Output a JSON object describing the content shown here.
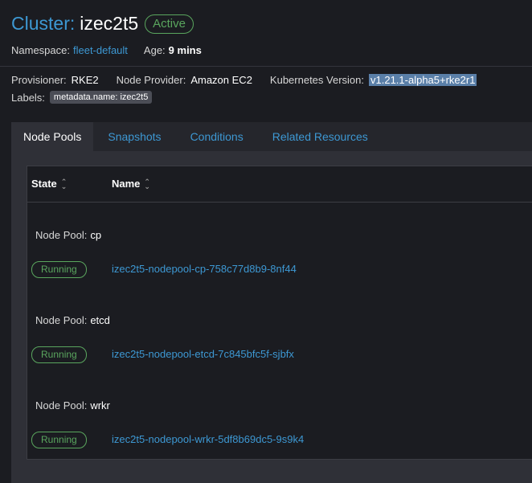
{
  "header": {
    "title_prefix": "Cluster:",
    "cluster_name": "izec2t5",
    "status": "Active"
  },
  "meta": {
    "namespace_label": "Namespace:",
    "namespace_value": "fleet-default",
    "age_label": "Age:",
    "age_value": "9 mins"
  },
  "details": {
    "provisioner_label": "Provisioner:",
    "provisioner_value": "RKE2",
    "node_provider_label": "Node Provider:",
    "node_provider_value": "Amazon EC2",
    "k8s_version_label": "Kubernetes Version:",
    "k8s_version_value": "v1.21.1-alpha5+rke2r1",
    "labels_label": "Labels:",
    "label_chip": "metadata.name: izec2t5"
  },
  "tabs": [
    {
      "label": "Node Pools",
      "active": true
    },
    {
      "label": "Snapshots",
      "active": false
    },
    {
      "label": "Conditions",
      "active": false
    },
    {
      "label": "Related Resources",
      "active": false
    }
  ],
  "table": {
    "columns": [
      "State",
      "Name"
    ],
    "groups": [
      {
        "prefix": "Node Pool:",
        "name": "cp",
        "state": "Running",
        "node": "izec2t5-nodepool-cp-758c77d8b9-8nf44"
      },
      {
        "prefix": "Node Pool:",
        "name": "etcd",
        "state": "Running",
        "node": "izec2t5-nodepool-etcd-7c845bfc5f-sjbfx"
      },
      {
        "prefix": "Node Pool:",
        "name": "wrkr",
        "state": "Running",
        "node": "izec2t5-nodepool-wrkr-5df8b69dc5-9s9k4"
      }
    ]
  },
  "colors": {
    "accent": "#3d98d3",
    "success": "#5aa65e",
    "background": "#1b1c21"
  }
}
